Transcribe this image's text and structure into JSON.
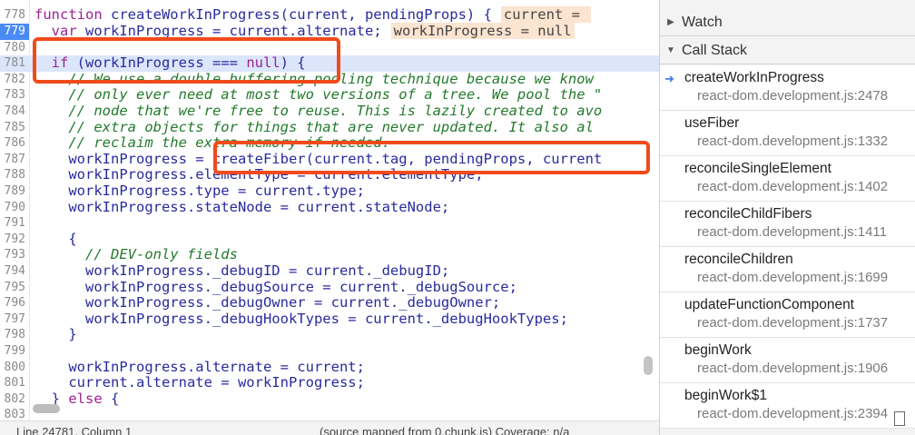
{
  "code_lines": [
    {
      "ln": "779",
      "active": true,
      "segs": [
        {
          "t": "  "
        },
        {
          "t": "var",
          "c": "kw"
        },
        {
          "t": " workInProgress = current.alternate;"
        },
        {
          "t": "workInProgress = null",
          "c": "inl"
        }
      ]
    },
    {
      "ln": "780",
      "segs": [
        {
          "t": ""
        }
      ]
    },
    {
      "ln": "781",
      "hl": true,
      "segs": [
        {
          "t": "  "
        },
        {
          "t": "if",
          "c": "kw"
        },
        {
          "t": " (workInProgress === "
        },
        {
          "t": "null",
          "c": "kw"
        },
        {
          "t": ") {"
        }
      ]
    },
    {
      "ln": "782",
      "segs": [
        {
          "t": "    // We use a double buffering pooling technique because we know",
          "c": "cm"
        }
      ]
    },
    {
      "ln": "783",
      "segs": [
        {
          "t": "    // only ever need at most two versions of a tree. We pool the \"",
          "c": "cm"
        }
      ]
    },
    {
      "ln": "784",
      "segs": [
        {
          "t": "    // node that we're free to reuse. This is lazily created to avo",
          "c": "cm"
        }
      ]
    },
    {
      "ln": "785",
      "segs": [
        {
          "t": "    // extra objects for things that are never updated. It also al",
          "c": "cm"
        }
      ]
    },
    {
      "ln": "786",
      "segs": [
        {
          "t": "    // reclaim the extra memory if needed.",
          "c": "cm"
        }
      ]
    },
    {
      "ln": "787",
      "segs": [
        {
          "t": "    workInProgress = createFiber(current.tag, pendingProps, current"
        }
      ]
    },
    {
      "ln": "788",
      "segs": [
        {
          "t": "    workInProgress.elementType = current.elementType;"
        }
      ]
    },
    {
      "ln": "789",
      "segs": [
        {
          "t": "    workInProgress.type = current.type;"
        }
      ]
    },
    {
      "ln": "790",
      "segs": [
        {
          "t": "    workInProgress.stateNode = current.stateNode;"
        }
      ]
    },
    {
      "ln": "791",
      "segs": [
        {
          "t": ""
        }
      ]
    },
    {
      "ln": "792",
      "segs": [
        {
          "t": "    {"
        }
      ]
    },
    {
      "ln": "793",
      "segs": [
        {
          "t": "      // DEV-only fields",
          "c": "cm"
        }
      ]
    },
    {
      "ln": "794",
      "segs": [
        {
          "t": "      workInProgress._debugID = current._debugID;"
        }
      ]
    },
    {
      "ln": "795",
      "segs": [
        {
          "t": "      workInProgress._debugSource = current._debugSource;"
        }
      ]
    },
    {
      "ln": "796",
      "segs": [
        {
          "t": "      workInProgress._debugOwner = current._debugOwner;"
        }
      ]
    },
    {
      "ln": "797",
      "segs": [
        {
          "t": "      workInProgress._debugHookTypes = current._debugHookTypes;"
        }
      ]
    },
    {
      "ln": "798",
      "segs": [
        {
          "t": "    }"
        }
      ]
    },
    {
      "ln": "799",
      "segs": [
        {
          "t": ""
        }
      ]
    },
    {
      "ln": "800",
      "segs": [
        {
          "t": "    workInProgress.alternate = current;"
        }
      ]
    },
    {
      "ln": "801",
      "segs": [
        {
          "t": "    current.alternate = workInProgress;"
        }
      ]
    },
    {
      "ln": "802",
      "segs": [
        {
          "t": "  } "
        },
        {
          "t": "else",
          "c": "kw"
        },
        {
          "t": " {"
        }
      ]
    },
    {
      "ln": "803",
      "segs": [
        {
          "t": ""
        }
      ]
    }
  ],
  "header_line": {
    "ln": "778",
    "segs": [
      {
        "t": "function",
        "c": "kw"
      },
      {
        "t": " createWorkInProgress(current, pendingProps) {"
      },
      {
        "t": "current = ",
        "c": "inl"
      }
    ]
  },
  "top_line_number": "777",
  "status": {
    "position": "Line 24781, Column 1",
    "source": "(source mapped from 0.chunk.js) Coverage: n/a"
  },
  "panel": {
    "watch_label": "Watch",
    "callstack_label": "Call Stack",
    "frames": [
      {
        "name": "createWorkInProgress",
        "loc": "react-dom.development.js:2478",
        "current": true
      },
      {
        "name": "useFiber",
        "loc": "react-dom.development.js:1332"
      },
      {
        "name": "reconcileSingleElement",
        "loc": "react-dom.development.js:1402"
      },
      {
        "name": "reconcileChildFibers",
        "loc": "react-dom.development.js:1411"
      },
      {
        "name": "reconcileChildren",
        "loc": "react-dom.development.js:1699"
      },
      {
        "name": "updateFunctionComponent",
        "loc": "react-dom.development.js:1737"
      },
      {
        "name": "beginWork",
        "loc": "react-dom.development.js:1906"
      },
      {
        "name": "beginWork$1",
        "loc": "react-dom.development.js:2394"
      }
    ]
  },
  "icons": {
    "current_frame": "arrow-right-icon",
    "expand": "triangle-right-icon",
    "collapse": "triangle-down-icon"
  },
  "colors": {
    "highlight_box": "#f24a1a",
    "active_line": "#4a8af4"
  }
}
